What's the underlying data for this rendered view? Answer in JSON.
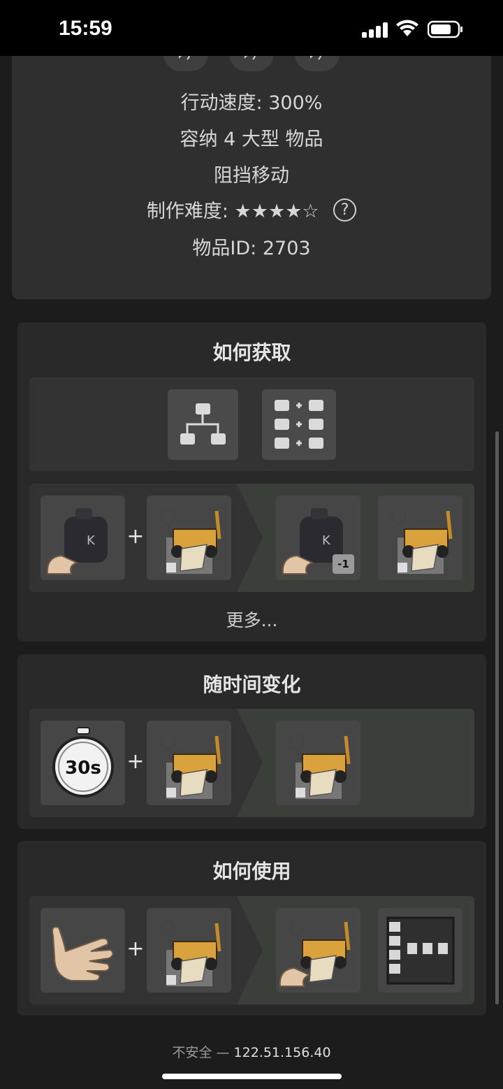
{
  "status_bar": {
    "time": "15:59"
  },
  "item_info": {
    "speed": "行动速度: 300%",
    "capacity": "容纳 4 大型 物品",
    "blocks": "阻挡移动",
    "difficulty_label": "制作难度:",
    "difficulty_stars": "★★★★☆",
    "difficulty_rating": 4,
    "difficulty_max": 5,
    "help_symbol": "?",
    "item_id": "物品ID: 2703"
  },
  "sections": {
    "obtain": {
      "title": "如何获取",
      "recipe": {
        "plus": "+",
        "badge": "-1"
      },
      "more": "更多..."
    },
    "decay": {
      "title": "随时间变化",
      "timer": "30s",
      "plus": "+"
    },
    "use": {
      "title": "如何使用",
      "plus": "+"
    }
  },
  "icons": {
    "sound": "speaker-icon",
    "tree": "tech-tree-icon",
    "grid": "recipe-grid-icon",
    "bag": "backpack-icon",
    "hand": "hand-icon",
    "cart": "crude-car-icon",
    "timer": "stopwatch-icon",
    "tile": "floor-tile-icon"
  },
  "browser": {
    "security": "不安全 —",
    "address": "122.51.156.40"
  }
}
